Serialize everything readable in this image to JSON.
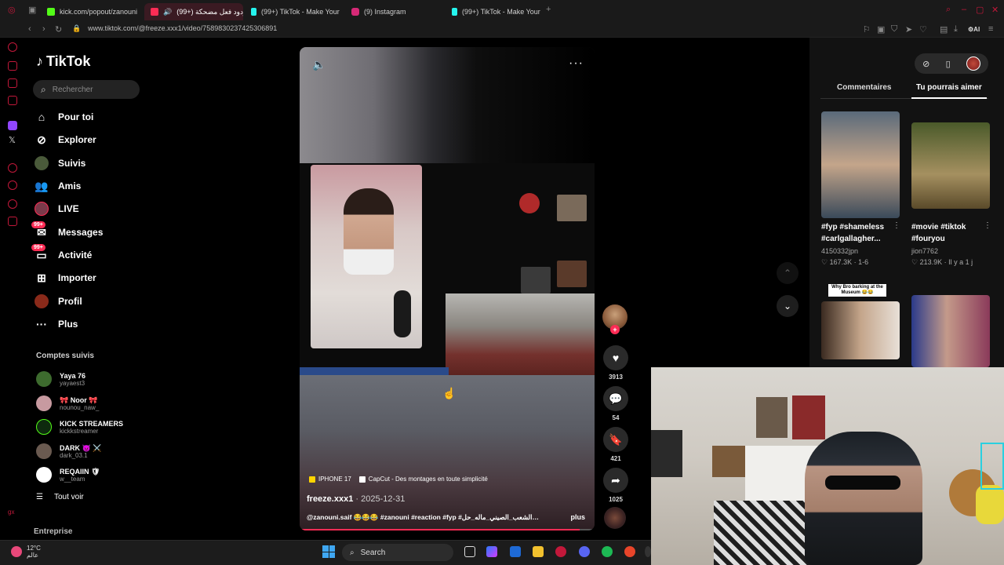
{
  "browser": {
    "tabs": [
      {
        "label": "kick.com/popout/zanouni",
        "color": "#53fc18"
      },
      {
        "label": "(99+) ردود فعل مضحكة",
        "color": "#fe2c55",
        "active": true
      },
      {
        "label": "(99+) TikTok - Make Your",
        "color": "#25f4ee"
      },
      {
        "label": "(9) Instagram",
        "color": "#d62976"
      },
      {
        "label": "(99+) TikTok - Make Your",
        "color": "#25f4ee"
      }
    ],
    "url": "www.tiktok.com/@freeze.xxx1/video/7589830237425306891"
  },
  "tiktok": {
    "logo_text": "TikTok",
    "search_placeholder": "Rechercher",
    "nav": [
      {
        "label": "Pour toi",
        "icon": "home-icon"
      },
      {
        "label": "Explorer",
        "icon": "compass-icon"
      },
      {
        "label": "Suivis",
        "icon": "following-icon"
      },
      {
        "label": "Amis",
        "icon": "friends-icon"
      },
      {
        "label": "LIVE",
        "icon": "live-icon"
      },
      {
        "label": "Messages",
        "icon": "messages-icon",
        "badge": "99+"
      },
      {
        "label": "Activité",
        "icon": "activity-icon",
        "badge": "99+"
      },
      {
        "label": "Importer",
        "icon": "upload-icon"
      },
      {
        "label": "Profil",
        "icon": "profile-icon"
      },
      {
        "label": "Plus",
        "icon": "more-icon"
      }
    ],
    "following_title": "Comptes suivis",
    "following": [
      {
        "name": "Yaya 76",
        "handle": "yayaest3",
        "color": "#3d6b2e"
      },
      {
        "name": "🎀 Noor 🎀",
        "handle": "nounou_naw_",
        "color": "#c79aa0"
      },
      {
        "name": "KICK STREAMERS",
        "handle": "kickkstreamer",
        "color": "#53fc18"
      },
      {
        "name": "DARK 👿 ⚔️",
        "handle": "dark_03.1",
        "color": "#6a5a50"
      },
      {
        "name": "REQAIIN 🛡",
        "handle": "w__team",
        "color": "#b02030"
      }
    ],
    "see_all": "Tout voir",
    "footer": "Entreprise"
  },
  "video": {
    "anchors": [
      "IPHONE 17",
      "CapCut - Des montages en toute simplicité"
    ],
    "author": "freeze.xxx1",
    "date": "2025-12-31",
    "caption": "@zanouni.saif 😂😂😂 #zanouni #reaction #fyp #الشعب_الصيني_ماله_حل…",
    "more": "plus",
    "progress": 0.95,
    "likes": "3913",
    "comments": "54",
    "saves": "421",
    "shares": "1025"
  },
  "right_panel": {
    "tabs": [
      "Commentaires",
      "Tu pourrais aimer"
    ],
    "active_tab": 1,
    "recommendations": [
      {
        "title": "#fyp #shameless #carlgallagher...",
        "author": "4150332jpn",
        "likes": "167.3K",
        "time": "1-6",
        "colors": [
          "#5a6a7a",
          "#c4a58a"
        ]
      },
      {
        "title": "#movie #tiktok #fouryou",
        "author": "jion7762",
        "likes": "213.9K",
        "time": "Il y a 1 j",
        "colors": [
          "#4a5a2a",
          "#a59060"
        ]
      }
    ],
    "rec3_label": "Why Bro barking at the Museum 😂😂"
  },
  "taskbar": {
    "temperature": "12°C",
    "weather_label": "عالم",
    "search": "Search"
  }
}
